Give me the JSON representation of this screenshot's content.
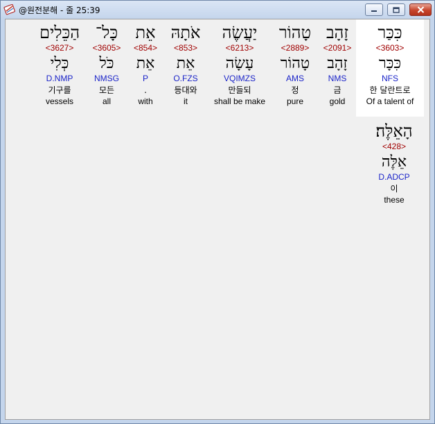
{
  "window": {
    "title": "@원전분해 - 줄 25:39"
  },
  "words": [
    {
      "hebrew": "כִּכַּר",
      "strongs": "<3603>",
      "lemma": "כִּכָּר",
      "morph": "NFS",
      "korean": "한 달란트로",
      "english": "Of a talent of"
    },
    {
      "hebrew": "זָהָב",
      "strongs": "<2091>",
      "lemma": "זָהָב",
      "morph": "NMS",
      "korean": "금",
      "english": "gold"
    },
    {
      "hebrew": "טָהוֹר",
      "strongs": "<2889>",
      "lemma": "טָהוֹר",
      "morph": "AMS",
      "korean": "정",
      "english": "pure"
    },
    {
      "hebrew": "יַעֲשֶׂה",
      "strongs": "<6213>",
      "lemma": "עָשָׂה",
      "morph": "VQIMZS",
      "korean": "만들되",
      "english": "shall be make"
    },
    {
      "hebrew": "אֹתָהּ",
      "strongs": "<853>",
      "lemma": "אֵת",
      "morph": "O.FZS",
      "korean": "등대와",
      "english": "it"
    },
    {
      "hebrew": "אֵת",
      "strongs": "<854>",
      "lemma": "אֵת",
      "morph": "P",
      "korean": ".",
      "english": "with"
    },
    {
      "hebrew": "כָּל־",
      "strongs": "<3605>",
      "lemma": "כֹּל",
      "morph": "NMSG",
      "korean": "모든",
      "english": "all"
    },
    {
      "hebrew": "הַכֵּלִים",
      "strongs": "<3627>",
      "lemma": "כְּלִי",
      "morph": "D.NMP",
      "korean": "기구를",
      "english": "vessels"
    },
    {
      "hebrew": "הָאֵלֶּה׃",
      "strongs": "<428>",
      "lemma": "אֵלֶּה",
      "morph": "D.ADCP",
      "korean": "이",
      "english": "these"
    }
  ]
}
